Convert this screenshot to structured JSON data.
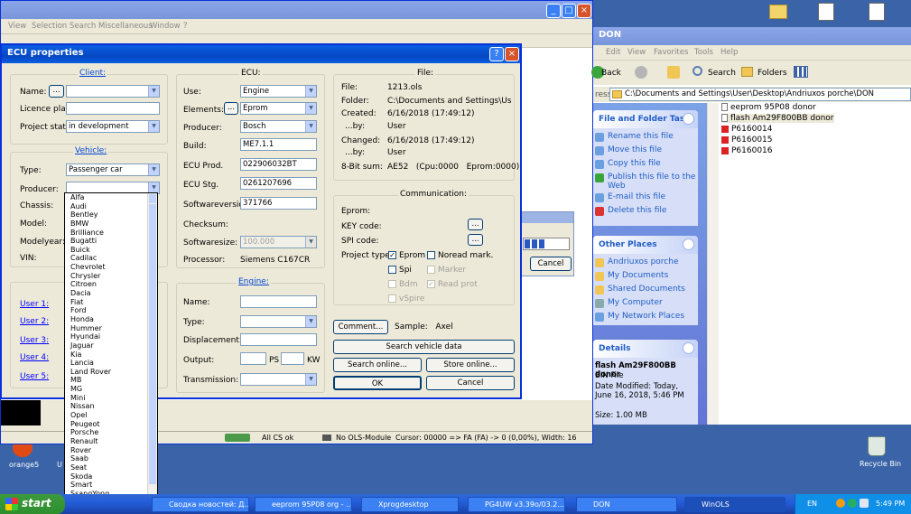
{
  "desktop": {
    "icons": [
      {
        "label": "orange5"
      },
      {
        "label": "Recycle Bin"
      },
      {
        "label": "U S"
      }
    ]
  },
  "background_app": {
    "menu": [
      "View",
      "Selection",
      "Search",
      "Miscellaneous",
      "Window",
      "?"
    ],
    "status": {
      "cs": "All CS ok",
      "module": "No OLS-Module",
      "cursor": "Cursor: 00000 => FA (FA) -> 0 (0,00%), Width: 16"
    },
    "small_dialog": {
      "cancel": "Cancel"
    }
  },
  "dialog": {
    "title": "ECU properties",
    "client": {
      "title": "Client:",
      "name_label": "Name:",
      "name_btn": "...",
      "licence_label": "Licence plate:",
      "project_state_label": "Project state:",
      "project_state": "in development"
    },
    "vehicle": {
      "title": "Vehicle:",
      "type_label": "Type:",
      "type": "Passenger car",
      "producer_label": "Producer:",
      "chassis_label": "Chassis:",
      "model_label": "Model:",
      "modelyear_label": "Modelyear:",
      "vin_label": "VIN:"
    },
    "users": [
      "User 1:",
      "User 2:",
      "User 3:",
      "User 4:",
      "User 5:"
    ],
    "producer_list": [
      "Alfa",
      "Audi",
      "Bentley",
      "BMW",
      "Brilliance",
      "Bugatti",
      "Buick",
      "Cadilac",
      "Chevrolet",
      "Chrysler",
      "Citroen",
      "Dacia",
      "Fiat",
      "Ford",
      "Honda",
      "Hummer",
      "Hyundai",
      "Jaguar",
      "Kia",
      "Lancia",
      "Land Rover",
      "MB",
      "MG",
      "Mini",
      "Nissan",
      "Opel",
      "Peugeot",
      "Porsche",
      "Renault",
      "Rover",
      "Saab",
      "Seat",
      "Skoda",
      "Smart",
      "SsangYong",
      "Subaru"
    ],
    "ecu": {
      "title": "ECU:",
      "use_label": "Use:",
      "use": "Engine",
      "elements_label": "Elements:",
      "elements_btn": "...",
      "elements": "Eprom",
      "producer_label": "Producer:",
      "producer": "Bosch",
      "build_label": "Build:",
      "build": "ME7.1.1",
      "prod_label": "ECU Prod.",
      "prod": "022906032BT",
      "stg_label": "ECU Stg.",
      "stg": "0261207696",
      "sw_label": "Softwareversion:",
      "sw": "371766",
      "checksum_label": "Checksum:",
      "swsize_label": "Softwaresize:",
      "swsize": "100.000",
      "processor_label": "Processor:",
      "processor": "Siemens C167CR"
    },
    "engine": {
      "title": "Engine:",
      "name_label": "Name:",
      "type_label": "Type:",
      "displacement_label": "Displacement:",
      "output_label": "Output:",
      "ps": "PS",
      "kw": "KW",
      "transmission_label": "Transmission:"
    },
    "file": {
      "title": "File:",
      "file_label": "File:",
      "file": "1213.ols",
      "folder_label": "Folder:",
      "folder": "C:\\Documents and Settings\\User\\My",
      "created_label": "Created:",
      "created": "6/16/2018 (17:49:12)",
      "by_label": "...by:",
      "by": "User",
      "changed_label": "Changed:",
      "changed": "6/16/2018 (17:49:12)",
      "by2": "User",
      "sum_label": "8-Bit sum:",
      "sum": "AE52   (Cpu:0000   Eprom:0000)"
    },
    "communication": {
      "title": "Communication:",
      "eprom_label": "Eprom:",
      "key_label": "KEY code:",
      "spi_label": "SPI code:",
      "btn": "...",
      "project_type_label": "Project type:",
      "checks": [
        {
          "label": "Eprom",
          "checked": true,
          "disabled": false
        },
        {
          "label": "Noread mark.",
          "checked": false,
          "disabled": false
        },
        {
          "label": "Spi",
          "checked": false,
          "disabled": false
        },
        {
          "label": "Marker",
          "checked": false,
          "disabled": true
        },
        {
          "label": "Bdm",
          "checked": false,
          "disabled": true
        },
        {
          "label": "Read prot",
          "checked": true,
          "disabled": true
        },
        {
          "label": "vSpire",
          "checked": false,
          "disabled": true
        }
      ]
    },
    "comment_btn": "Comment...",
    "sample": "Sample:   Axel",
    "search_vehicle": "Search vehicle data",
    "search_online": "Search online...",
    "store_online": "Store online...",
    "ok": "OK",
    "cancel": "Cancel"
  },
  "explorer": {
    "title": "DON",
    "menu": [
      "Edit",
      "View",
      "Favorites",
      "Tools",
      "Help"
    ],
    "back": "Back",
    "search": "Search",
    "folders": "Folders",
    "address_label": "ress",
    "address": "C:\\Documents and Settings\\User\\Desktop\\Andriuxos porche\\DON",
    "tasks_title": "File and Folder Tasks",
    "tasks": [
      "Rename this file",
      "Move this file",
      "Copy this file",
      "Publish this file to the Web",
      "E-mail this file",
      "Delete this file"
    ],
    "places_title": "Other Places",
    "places": [
      "Andriuxos porche",
      "My Documents",
      "Shared Documents",
      "My Computer",
      "My Network Places"
    ],
    "details_title": "Details",
    "details_name": "flash Am29F800BB donor",
    "details_type": "BIN File",
    "details_date": "Date Modified: Today, June 16, 2018, 5:46 PM",
    "details_size": "Size: 1.00 MB",
    "files": [
      "eeprom 95P08 donor",
      "flash Am29F800BB donor",
      "P6160014",
      "P6160015",
      "P6160016"
    ]
  },
  "taskbar": {
    "start": "start",
    "buttons": [
      "Сводка новостей: Д...",
      "eeprom 95P08 org - ...",
      "Xprogdesktop",
      "PG4UW v3.39o/03.2...",
      "DON",
      "WinOLS"
    ],
    "lang": "EN",
    "clock": "5:49 PM"
  },
  "colors": {
    "xp_blue": "#0a5fe4",
    "dialog_bg": "#ece9d8",
    "link": "#0000ff",
    "group_title": "#0046d5"
  }
}
